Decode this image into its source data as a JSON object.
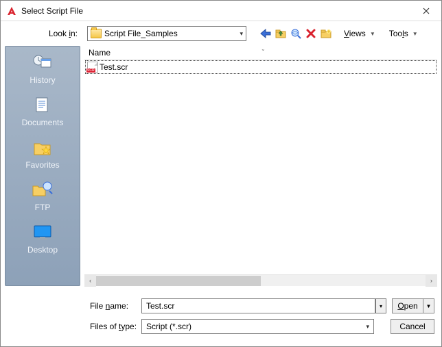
{
  "title": "Select Script File",
  "lookin": {
    "label": "Look in:",
    "value": "Script File_Samples"
  },
  "toolbar": {
    "back_icon": "back-arrow",
    "up_icon": "up-folder",
    "search_icon": "search-web",
    "delete_icon": "delete-x",
    "new_icon": "new-folder",
    "views_label": "Views",
    "tools_label": "Tools"
  },
  "sidebar": {
    "items": [
      {
        "label": "History",
        "icon": "history"
      },
      {
        "label": "Documents",
        "icon": "documents"
      },
      {
        "label": "Favorites",
        "icon": "favorites"
      },
      {
        "label": "FTP",
        "icon": "ftp"
      },
      {
        "label": "Desktop",
        "icon": "desktop"
      }
    ]
  },
  "filelist": {
    "header": "Name",
    "items": [
      {
        "name": "Test.scr"
      }
    ]
  },
  "filename": {
    "label": "File name:",
    "value": "Test.scr",
    "open_label": "Open"
  },
  "filetype": {
    "label": "Files of type:",
    "value": "Script (*.scr)",
    "cancel_label": "Cancel"
  }
}
